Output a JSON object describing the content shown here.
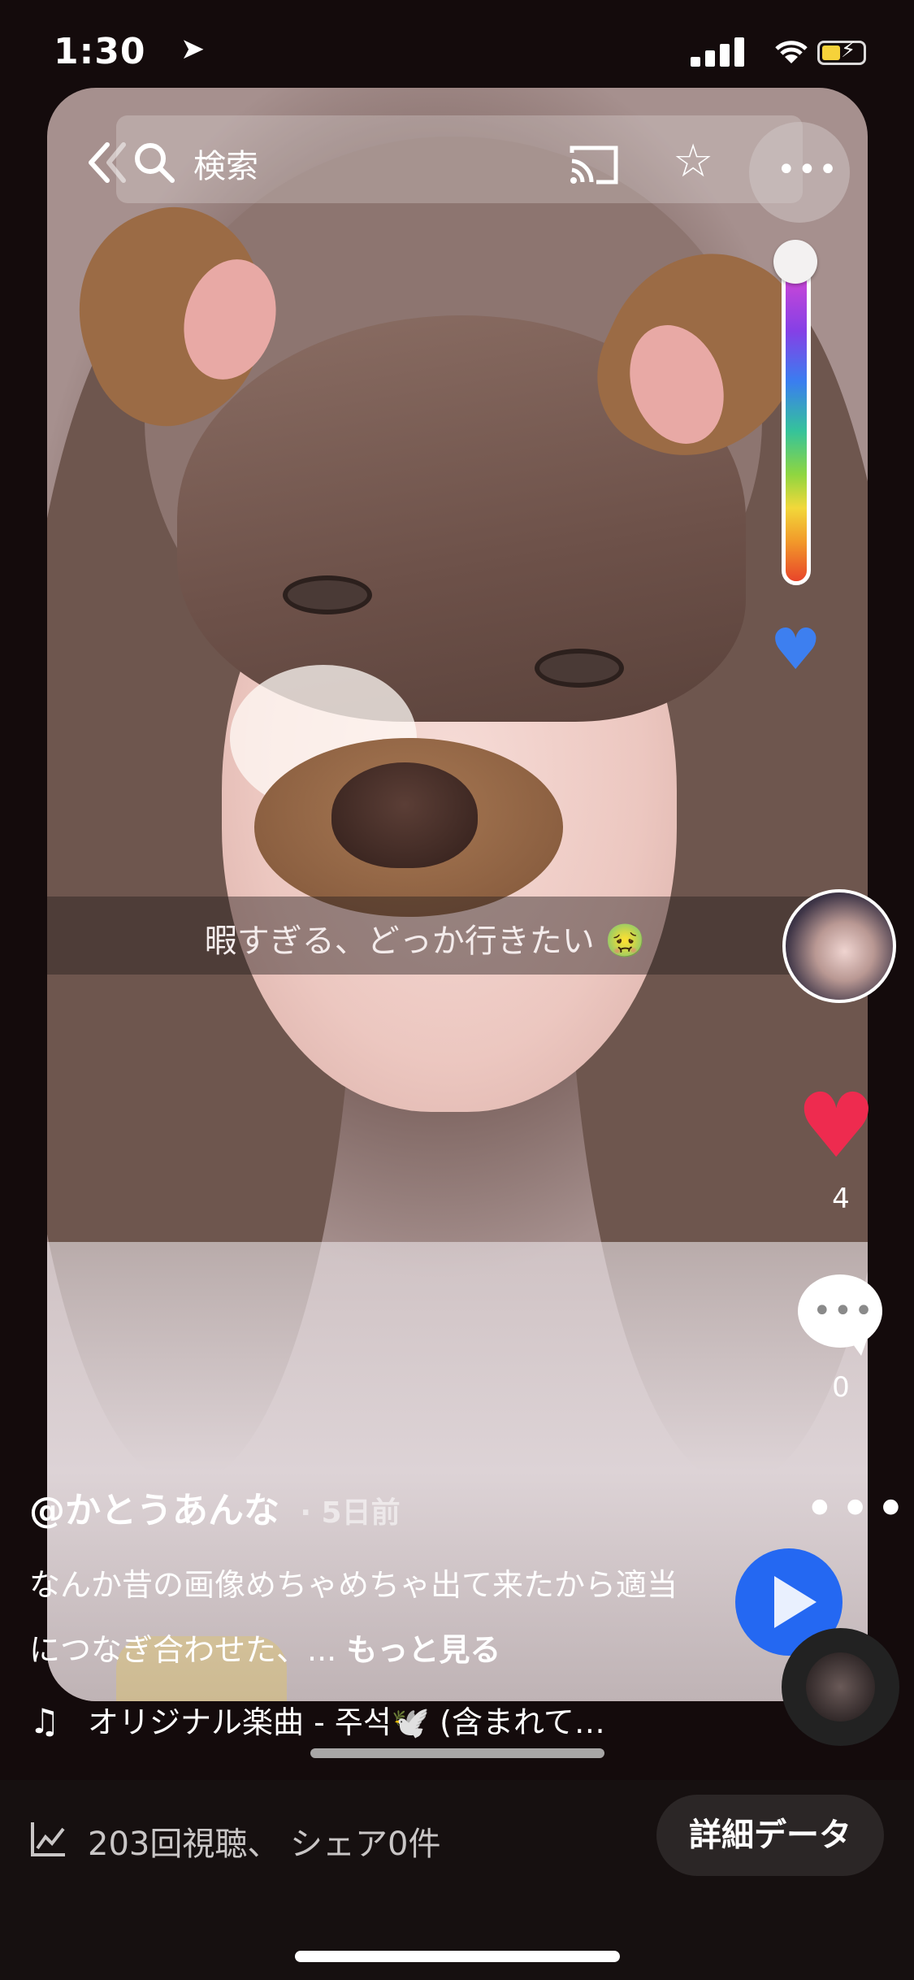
{
  "status_bar": {
    "time": "1:30",
    "location_arrow": "➤"
  },
  "top_bar": {
    "search_label": "検索",
    "more_label": "•••",
    "star": "☆"
  },
  "video": {
    "caption": "暇すぎる、どっか行きたい 🤢"
  },
  "actions": {
    "like_count": "4",
    "comment_count": "0",
    "more_label": "•••"
  },
  "post": {
    "username": "@かとうあんな",
    "age": "· 5日前",
    "description": "なんか昔の画像めちゃめちゃ出て来たから適当につなぎ合わせた、... ",
    "see_more": "もっと見る",
    "music_note": "♫",
    "music": "オリジナル楽曲 - 주석🕊️ (含まれて…"
  },
  "bottom_bar": {
    "stats": "203回視聴、 シェア0件",
    "details_button": "詳細データ"
  },
  "colors": {
    "like": "#ee2b4f",
    "share": "#2468f2",
    "background": "#140b0c"
  }
}
